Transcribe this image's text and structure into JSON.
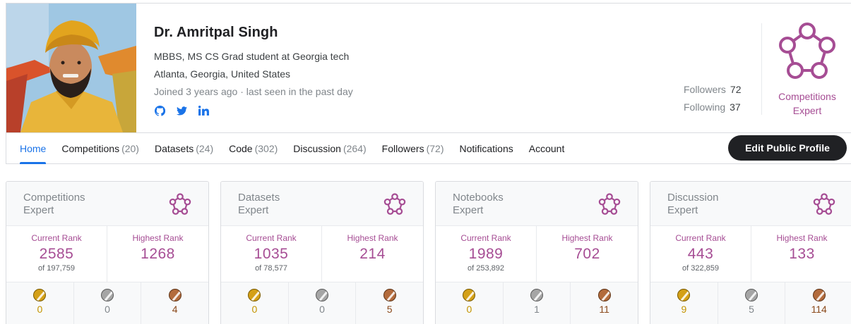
{
  "profile": {
    "name": "Dr. Amritpal Singh",
    "bio": "MBBS, MS CS Grad student at Georgia tech",
    "location": "Atlanta, Georgia, United States",
    "activity": "Joined 3 years ago · last seen in the past day",
    "socials": [
      "github-icon",
      "twitter-icon",
      "linkedin-icon"
    ],
    "followers_label": "Followers",
    "followers_count": "72",
    "following_label": "Following",
    "following_count": "37",
    "tier_line1": "Competitions",
    "tier_line2": "Expert",
    "tier_color": "#a64d94"
  },
  "nav": {
    "tabs": [
      {
        "label": "Home",
        "count": ""
      },
      {
        "label": "Competitions",
        "count": "(20)"
      },
      {
        "label": "Datasets",
        "count": "(24)"
      },
      {
        "label": "Code",
        "count": "(302)"
      },
      {
        "label": "Discussion",
        "count": "(264)"
      },
      {
        "label": "Followers",
        "count": "(72)"
      },
      {
        "label": "Notifications",
        "count": ""
      },
      {
        "label": "Account",
        "count": ""
      }
    ],
    "active": "Home",
    "edit_button": "Edit Public Profile"
  },
  "cards": [
    {
      "category": "Competitions",
      "tier": "Expert",
      "current_label": "Current Rank",
      "current_rank": "2585",
      "of_total": "of 197,759",
      "highest_label": "Highest Rank",
      "highest_rank": "1268",
      "gold": "0",
      "silver": "0",
      "bronze": "4"
    },
    {
      "category": "Datasets",
      "tier": "Expert",
      "current_label": "Current Rank",
      "current_rank": "1035",
      "of_total": "of 78,577",
      "highest_label": "Highest Rank",
      "highest_rank": "214",
      "gold": "0",
      "silver": "0",
      "bronze": "5"
    },
    {
      "category": "Notebooks",
      "tier": "Expert",
      "current_label": "Current Rank",
      "current_rank": "1989",
      "of_total": "of 253,892",
      "highest_label": "Highest Rank",
      "highest_rank": "702",
      "gold": "0",
      "silver": "1",
      "bronze": "11"
    },
    {
      "category": "Discussion",
      "tier": "Expert",
      "current_label": "Current Rank",
      "current_rank": "443",
      "of_total": "of 322,859",
      "highest_label": "Highest Rank",
      "highest_rank": "133",
      "gold": "9",
      "silver": "5",
      "bronze": "114"
    }
  ],
  "colors": {
    "accent": "#1a73e8",
    "expert": "#a64d94",
    "gold": "#d4a017",
    "silver": "#a5a5a5",
    "bronze": "#b36b3c"
  }
}
